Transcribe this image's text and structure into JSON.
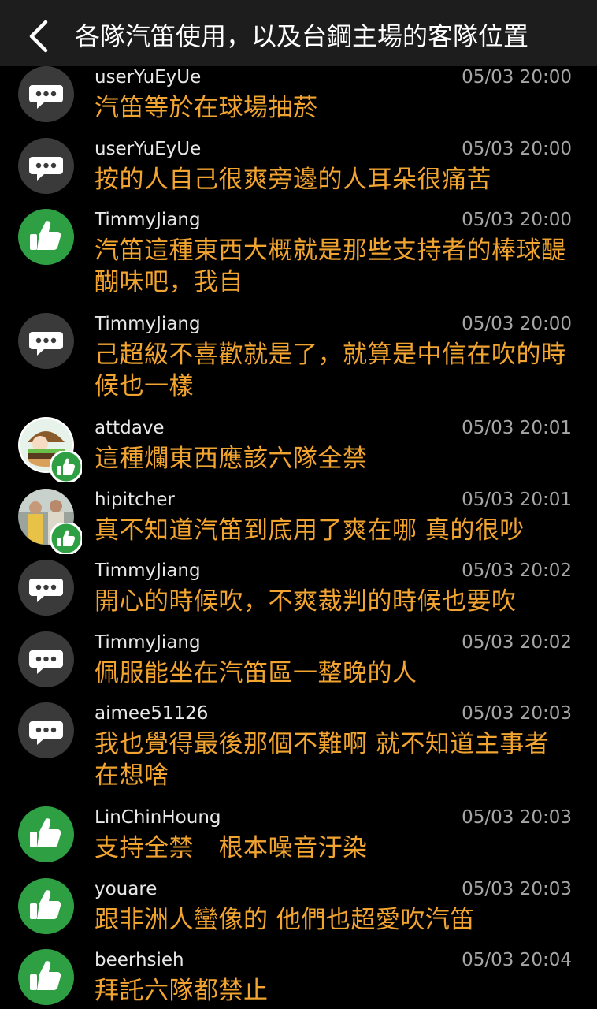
{
  "header": {
    "title": "各隊汽笛使用，以及台鋼主場的客隊位置"
  },
  "colors": {
    "background": "#000000",
    "header": "#1d1d1d",
    "message": "#f2a431",
    "like_green": "#2ea043",
    "comment_gray": "#3a3a3a"
  },
  "comments": [
    {
      "user": "userYuEyUe",
      "time": "05/03 20:00",
      "text": "汽笛等於在球場抽菸",
      "icon": "comment-icon"
    },
    {
      "user": "userYuEyUe",
      "time": "05/03 20:00",
      "text": "按的人自己很爽旁邊的人耳朵很痛苦",
      "icon": "comment-icon"
    },
    {
      "user": "TimmyJiang",
      "time": "05/03 20:00",
      "text": "汽笛這種東西大概就是那些支持者的棒球醍醐味吧，我自",
      "icon": "thumbs-up-icon"
    },
    {
      "user": "TimmyJiang",
      "time": "05/03 20:00",
      "text": "己超級不喜歡就是了，就算是中信在吹的時候也一樣",
      "icon": "comment-icon"
    },
    {
      "user": "attdave",
      "time": "05/03 20:01",
      "text": "這種爛東西應該六隊全禁",
      "icon": "burger-avatar"
    },
    {
      "user": "hipitcher",
      "time": "05/03 20:01",
      "text": "真不知道汽笛到底用了爽在哪 真的很吵",
      "icon": "photo-avatar"
    },
    {
      "user": "TimmyJiang",
      "time": "05/03 20:02",
      "text": "開心的時候吹，不爽裁判的時候也要吹",
      "icon": "comment-icon"
    },
    {
      "user": "TimmyJiang",
      "time": "05/03 20:02",
      "text": "佩服能坐在汽笛區一整晚的人",
      "icon": "comment-icon"
    },
    {
      "user": "aimee51126",
      "time": "05/03 20:03",
      "text": "我也覺得最後那個不難啊 就不知道主事者在想啥",
      "icon": "comment-icon"
    },
    {
      "user": "LinChinHoung",
      "time": "05/03 20:03",
      "text": "支持全禁　根本噪音汙染",
      "icon": "thumbs-up-icon"
    },
    {
      "user": "youare",
      "time": "05/03 20:03",
      "text": "跟非洲人蠻像的 他們也超愛吹汽笛",
      "icon": "thumbs-up-icon"
    },
    {
      "user": "beerhsieh",
      "time": "05/03 20:04",
      "text": "拜託六隊都禁止",
      "icon": "thumbs-up-icon"
    }
  ]
}
